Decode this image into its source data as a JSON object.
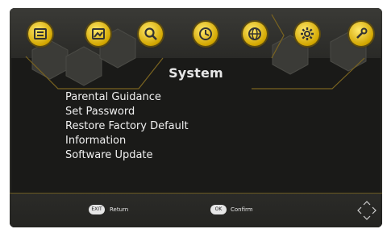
{
  "screen": {
    "title": "System"
  },
  "top_icons": [
    {
      "name": "channel-list-icon"
    },
    {
      "name": "picture-icon"
    },
    {
      "name": "search-icon"
    },
    {
      "name": "timer-icon"
    },
    {
      "name": "language-icon"
    },
    {
      "name": "system-gear-icon"
    },
    {
      "name": "tools-icon"
    }
  ],
  "menu": {
    "items": [
      {
        "label": "Parental Guidance"
      },
      {
        "label": "Set Password"
      },
      {
        "label": "Restore Factory Default"
      },
      {
        "label": "Information"
      },
      {
        "label": "Software Update"
      }
    ]
  },
  "footer": {
    "return": {
      "key": "EXIT",
      "label": "Return"
    },
    "confirm": {
      "key": "OK",
      "label": "Confirm"
    }
  },
  "colors": {
    "accent": "#d2a600",
    "background": "#1a1a18"
  }
}
